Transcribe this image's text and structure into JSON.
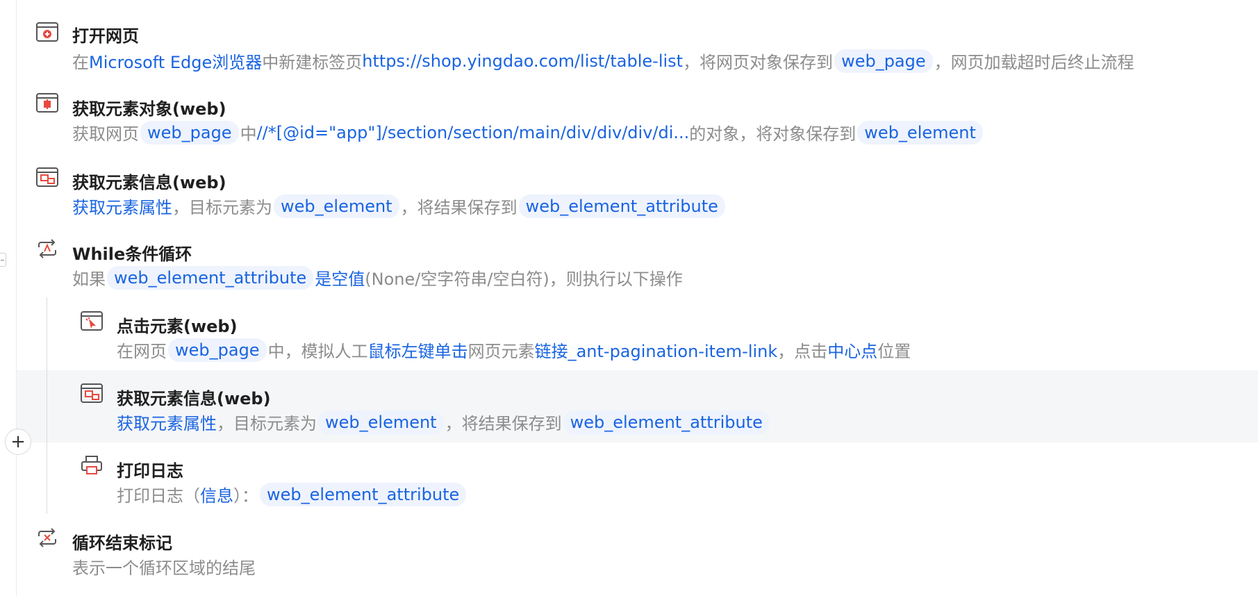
{
  "steps": [
    {
      "title": "打开网页",
      "icon": "browser-open-icon",
      "desc": {
        "t1": "在",
        "browser": "Microsoft Edge浏览器",
        "t2": "中新建标签页",
        "url": "https://shop.yingdao.com/list/table-list",
        "t3": "，将网页对象保存到",
        "var": "web_page",
        "t4": "，网页加载超时后终止流程"
      }
    },
    {
      "title": "获取元素对象(web)",
      "icon": "element-object-icon",
      "desc": {
        "t1": "获取网页",
        "var1": "web_page",
        "t2": "中",
        "xpath": "//*[@id=\"app\"]/section/section/main/div/div/div/di...",
        "t3": "的对象，将对象保存到",
        "var2": "web_element"
      }
    },
    {
      "title": "获取元素信息(web)",
      "icon": "element-info-icon",
      "desc": {
        "op": "获取元素属性",
        "t1": "，目标元素为",
        "var1": "web_element",
        "t2": "，将结果保存到",
        "var2": "web_element_attribute"
      }
    },
    {
      "title": "While条件循环",
      "icon": "loop-icon",
      "desc": {
        "t1": "如果",
        "var": "web_element_attribute",
        "cond": "是空值",
        "t2": "(None/空字符串/空白符)，则执行以下操作"
      }
    },
    {
      "title": "点击元素(web)",
      "icon": "click-element-icon",
      "desc": {
        "t1": "在网页",
        "var": "web_page",
        "t2": "中，模拟人工",
        "action": "鼠标左键单击",
        "t3": "网页元素",
        "target": "链接_ant-pagination-item-link",
        "t4": "，点击",
        "point": "中心点",
        "t5": "位置"
      }
    },
    {
      "title": "获取元素信息(web)",
      "icon": "element-info-icon",
      "desc": {
        "op": "获取元素属性",
        "t1": "，目标元素为",
        "var1": "web_element",
        "t2": "，将结果保存到",
        "var2": "web_element_attribute"
      }
    },
    {
      "title": "打印日志",
      "icon": "print-icon",
      "desc": {
        "t1": "打印日志（",
        "level": "信息",
        "t2": "）：",
        "var": "web_element_attribute"
      }
    },
    {
      "title": "循环结束标记",
      "icon": "loop-end-icon",
      "desc": {
        "t1": "表示一个循环区域的结尾"
      }
    }
  ],
  "add_button": {
    "symbol": "+"
  },
  "colors": {
    "link": "#1a64e0",
    "pill_bg": "#eef3fd",
    "muted": "#8c8c8c",
    "icon_red": "#e8493f"
  }
}
